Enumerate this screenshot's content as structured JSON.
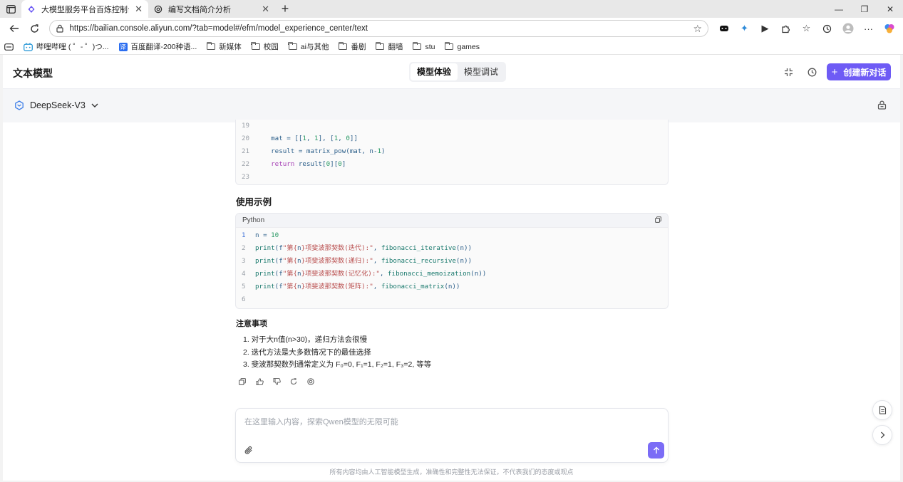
{
  "browser": {
    "tabs": [
      {
        "title": "大模型服务平台百炼控制台",
        "active": true
      },
      {
        "title": "编写文档简介分析",
        "active": false
      }
    ],
    "url": "https://bailian.console.aliyun.com/?tab=model#/efm/model_experience_center/text",
    "bookmarks": [
      {
        "label": "哔哩哔哩 ( ゜- ゜)つ...",
        "icon": "bilibili-icon"
      },
      {
        "label": "百度翻译-200种语...",
        "icon": "translate-icon"
      },
      {
        "label": "新媒体",
        "icon": "folder-icon"
      },
      {
        "label": "校园",
        "icon": "folder-icon"
      },
      {
        "label": "ai与其他",
        "icon": "folder-icon"
      },
      {
        "label": "番剧",
        "icon": "folder-icon"
      },
      {
        "label": "翻墙",
        "icon": "folder-icon"
      },
      {
        "label": "stu",
        "icon": "folder-icon"
      },
      {
        "label": "games",
        "icon": "folder-icon"
      }
    ]
  },
  "header": {
    "title": "文本模型",
    "segments": [
      {
        "label": "模型体验",
        "active": true
      },
      {
        "label": "模型调试",
        "active": false
      }
    ],
    "new_chat_label": "创建新对话",
    "accent_color": "#6e5bf5"
  },
  "model_bar": {
    "model_name": "DeepSeek-V3"
  },
  "code_block_1": {
    "lines": [
      {
        "n": "19",
        "tokens": [
          {
            "t": "",
            "c": ""
          }
        ]
      },
      {
        "n": "20",
        "tokens": [
          {
            "t": "    mat = [[",
            "c": ""
          },
          {
            "t": "1",
            "c": "num"
          },
          {
            "t": ", ",
            "c": ""
          },
          {
            "t": "1",
            "c": "num"
          },
          {
            "t": "], [",
            "c": ""
          },
          {
            "t": "1",
            "c": "num"
          },
          {
            "t": ", ",
            "c": ""
          },
          {
            "t": "0",
            "c": "num"
          },
          {
            "t": "]]",
            "c": ""
          }
        ]
      },
      {
        "n": "21",
        "tokens": [
          {
            "t": "    result = matrix_pow(mat, n-",
            "c": ""
          },
          {
            "t": "1",
            "c": "num"
          },
          {
            "t": ")",
            "c": ""
          }
        ]
      },
      {
        "n": "22",
        "tokens": [
          {
            "t": "    ",
            "c": ""
          },
          {
            "t": "return",
            "c": "kw"
          },
          {
            "t": " result[",
            "c": ""
          },
          {
            "t": "0",
            "c": "num"
          },
          {
            "t": "][",
            "c": ""
          },
          {
            "t": "0",
            "c": "num"
          },
          {
            "t": "]",
            "c": ""
          }
        ]
      },
      {
        "n": "23",
        "tokens": [
          {
            "t": "",
            "c": ""
          }
        ]
      }
    ]
  },
  "usage_heading": "使用示例",
  "code_block_2": {
    "language": "Python",
    "lines": [
      {
        "n": "1",
        "tokens": [
          {
            "t": "n = ",
            "c": ""
          },
          {
            "t": "10",
            "c": "num"
          }
        ]
      },
      {
        "n": "2",
        "tokens": [
          {
            "t": "print",
            "c": "fn"
          },
          {
            "t": "(f",
            "c": ""
          },
          {
            "t": "\"第{",
            "c": "str"
          },
          {
            "t": "n",
            "c": ""
          },
          {
            "t": "}项斐波那契数(迭代):\"",
            "c": "str"
          },
          {
            "t": ", ",
            "c": ""
          },
          {
            "t": "fibonacci_iterative",
            "c": "fn"
          },
          {
            "t": "(n))",
            "c": ""
          }
        ]
      },
      {
        "n": "3",
        "tokens": [
          {
            "t": "print",
            "c": "fn"
          },
          {
            "t": "(f",
            "c": ""
          },
          {
            "t": "\"第{",
            "c": "str"
          },
          {
            "t": "n",
            "c": ""
          },
          {
            "t": "}项斐波那契数(递归):\"",
            "c": "str"
          },
          {
            "t": ", ",
            "c": ""
          },
          {
            "t": "fibonacci_recursive",
            "c": "fn"
          },
          {
            "t": "(n))",
            "c": ""
          }
        ]
      },
      {
        "n": "4",
        "tokens": [
          {
            "t": "print",
            "c": "fn"
          },
          {
            "t": "(f",
            "c": ""
          },
          {
            "t": "\"第{",
            "c": "str"
          },
          {
            "t": "n",
            "c": ""
          },
          {
            "t": "}项斐波那契数(记忆化):\"",
            "c": "str"
          },
          {
            "t": ", ",
            "c": ""
          },
          {
            "t": "fibonacci_memoization",
            "c": "fn"
          },
          {
            "t": "(n))",
            "c": ""
          }
        ]
      },
      {
        "n": "5",
        "tokens": [
          {
            "t": "print",
            "c": "fn"
          },
          {
            "t": "(f",
            "c": ""
          },
          {
            "t": "\"第{",
            "c": "str"
          },
          {
            "t": "n",
            "c": ""
          },
          {
            "t": "}项斐波那契数(矩阵):\"",
            "c": "str"
          },
          {
            "t": ", ",
            "c": ""
          },
          {
            "t": "fibonacci_matrix",
            "c": "fn"
          },
          {
            "t": "(n))",
            "c": ""
          }
        ]
      },
      {
        "n": "6",
        "tokens": [
          {
            "t": "",
            "c": ""
          }
        ]
      }
    ]
  },
  "notes_heading": "注意事项",
  "notes": [
    "1. 对于大n值(n>30)，递归方法会很慢",
    "2. 迭代方法是大多数情况下的最佳选择",
    "3. 斐波那契数列通常定义为 F₀=0, F₁=1, F₂=1, F₃=2, 等等"
  ],
  "input": {
    "placeholder": "在这里输入内容，探索Qwen模型的无限可能",
    "value": ""
  },
  "disclaimer": "所有内容均由人工智能模型生成，准确性和完整性无法保证，不代表我们的态度或观点"
}
